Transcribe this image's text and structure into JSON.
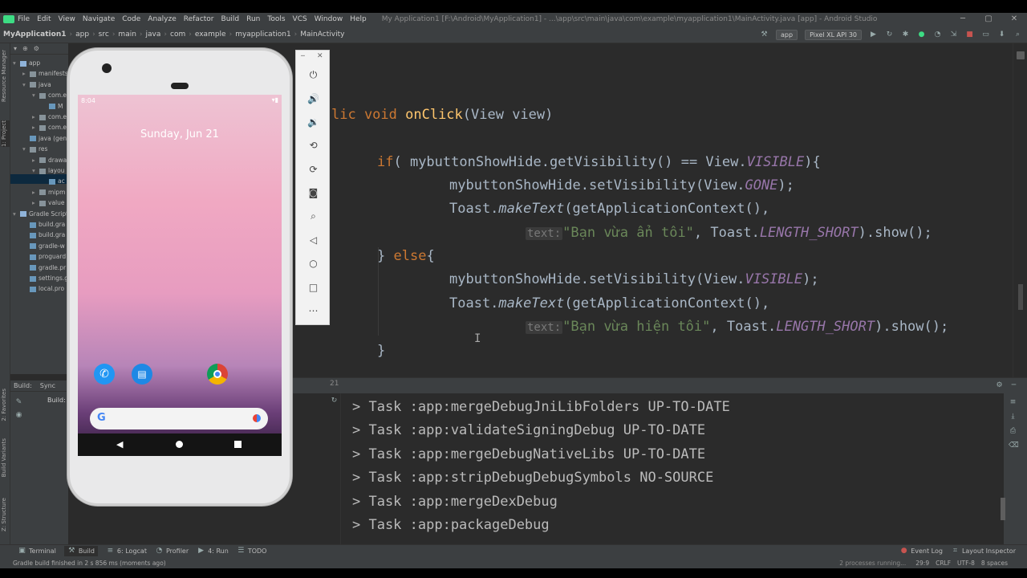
{
  "menu": {
    "items": [
      "File",
      "Edit",
      "View",
      "Navigate",
      "Code",
      "Analyze",
      "Refactor",
      "Build",
      "Run",
      "Tools",
      "VCS",
      "Window",
      "Help"
    ],
    "window_title": "My Application1 [F:\\Android\\MyApplication1] - ...\\app\\src\\main\\java\\com\\example\\myapplication1\\MainActivity.java [app] - Android Studio"
  },
  "nav": {
    "crumbs": [
      "MyApplication1",
      "app",
      "src",
      "main",
      "java",
      "com",
      "example",
      "myapplication1",
      "MainActivity"
    ],
    "run_config": "app",
    "device": "Pixel XL API 30"
  },
  "project": {
    "tree": [
      {
        "label": "app",
        "depth": 0,
        "arrow": "▾"
      },
      {
        "label": "manifests",
        "depth": 1,
        "arrow": "▸"
      },
      {
        "label": "java",
        "depth": 1,
        "arrow": "▾"
      },
      {
        "label": "com.e",
        "depth": 2,
        "arrow": "▾"
      },
      {
        "label": "M",
        "depth": 3,
        "arrow": ""
      },
      {
        "label": "com.e",
        "depth": 2,
        "arrow": "▸"
      },
      {
        "label": "com.e",
        "depth": 2,
        "arrow": "▸"
      },
      {
        "label": "java (gen",
        "depth": 1,
        "arrow": ""
      },
      {
        "label": "res",
        "depth": 1,
        "arrow": "▾"
      },
      {
        "label": "drawa",
        "depth": 2,
        "arrow": "▸"
      },
      {
        "label": "layou",
        "depth": 2,
        "arrow": "▾"
      },
      {
        "label": "ac",
        "depth": 3,
        "arrow": ""
      },
      {
        "label": "mipm",
        "depth": 2,
        "arrow": "▸"
      },
      {
        "label": "value",
        "depth": 2,
        "arrow": "▸"
      },
      {
        "label": "Gradle Scripts",
        "depth": 0,
        "arrow": "▾"
      },
      {
        "label": "build.gra",
        "depth": 1,
        "arrow": ""
      },
      {
        "label": "build.gra",
        "depth": 1,
        "arrow": ""
      },
      {
        "label": "gradle-w",
        "depth": 1,
        "arrow": ""
      },
      {
        "label": "proguard",
        "depth": 1,
        "arrow": ""
      },
      {
        "label": "gradle.pr",
        "depth": 1,
        "arrow": ""
      },
      {
        "label": "settings.g",
        "depth": 1,
        "arrow": ""
      },
      {
        "label": "local.pro",
        "depth": 1,
        "arrow": ""
      }
    ]
  },
  "left_tabs": [
    "Resource Manager",
    "1: Project",
    "2: Favorites",
    "Build Variants",
    "Z: Structure"
  ],
  "build": {
    "tab_build": "Build:",
    "tab_sync": "Sync",
    "node": "Build:"
  },
  "code": {
    "l1_kw": "lic void ",
    "l1_fn": "onClick",
    "l1_rest": "(View view)",
    "l2_kw": "if",
    "l2_a": "( mybuttonShowHide.getVisibility() == View.",
    "l2_f": "VISIBLE",
    "l2_b": "){",
    "l3_a": "mybuttonShowHide.setVisibility(View.",
    "l3_f": "GONE",
    "l3_b": ");",
    "l4_a": "Toast.",
    "l4_m": "makeText",
    "l4_b": "(getApplicationContext(),",
    "hint": "text:",
    "s1": "\"Bạn vừa ẩn tôi\"",
    "l5_b": ", Toast.",
    "l5_f": "LENGTH_SHORT",
    "l5_c": ").show();",
    "l6_a": "} ",
    "l6_kw": "else",
    "l6_b": "{",
    "l7_a": "mybuttonShowHide.setVisibility(View.",
    "l7_f": "VISIBLE",
    "l7_b": ");",
    "l8_a": "Toast.",
    "l8_m": "makeText",
    "l8_b": "(getApplicationContext(),",
    "s2": "\"Bạn vừa hiện tôi\"",
    "l9_b": ", Toast.",
    "l9_f": "LENGTH_SHORT",
    "l9_c": ").show();",
    "l10": "}"
  },
  "console": {
    "lines": [
      "> Task :app:mergeDebugJniLibFolders UP-TO-DATE",
      "> Task :app:validateSigningDebug UP-TO-DATE",
      "> Task :app:mergeDebugNativeLibs UP-TO-DATE",
      "> Task :app:stripDebugDebugSymbols NO-SOURCE",
      "> Task :app:mergeDexDebug",
      "> Task :app:packageDebug"
    ]
  },
  "bottom_tabs": [
    "Terminal",
    "Build",
    "6: Logcat",
    "Profiler",
    "4: Run",
    "TODO"
  ],
  "bottom_right": {
    "event_log": "Event Log",
    "layout_inspector": "Layout Inspector"
  },
  "status": {
    "message": "Gradle build finished in 2 s 856 ms (moments ago)",
    "processes": "2 processes running...",
    "position": "29:9",
    "line_sep": "CRLF",
    "encoding": "UTF-8",
    "indent": "8 spaces"
  },
  "phone": {
    "time": "8:04",
    "date": "Sunday, Jun 21"
  },
  "colors": {
    "keyword": "#cc7832",
    "function": "#ffc66d",
    "field": "#9876aa",
    "string": "#6a8759",
    "text": "#a9b7c6"
  }
}
